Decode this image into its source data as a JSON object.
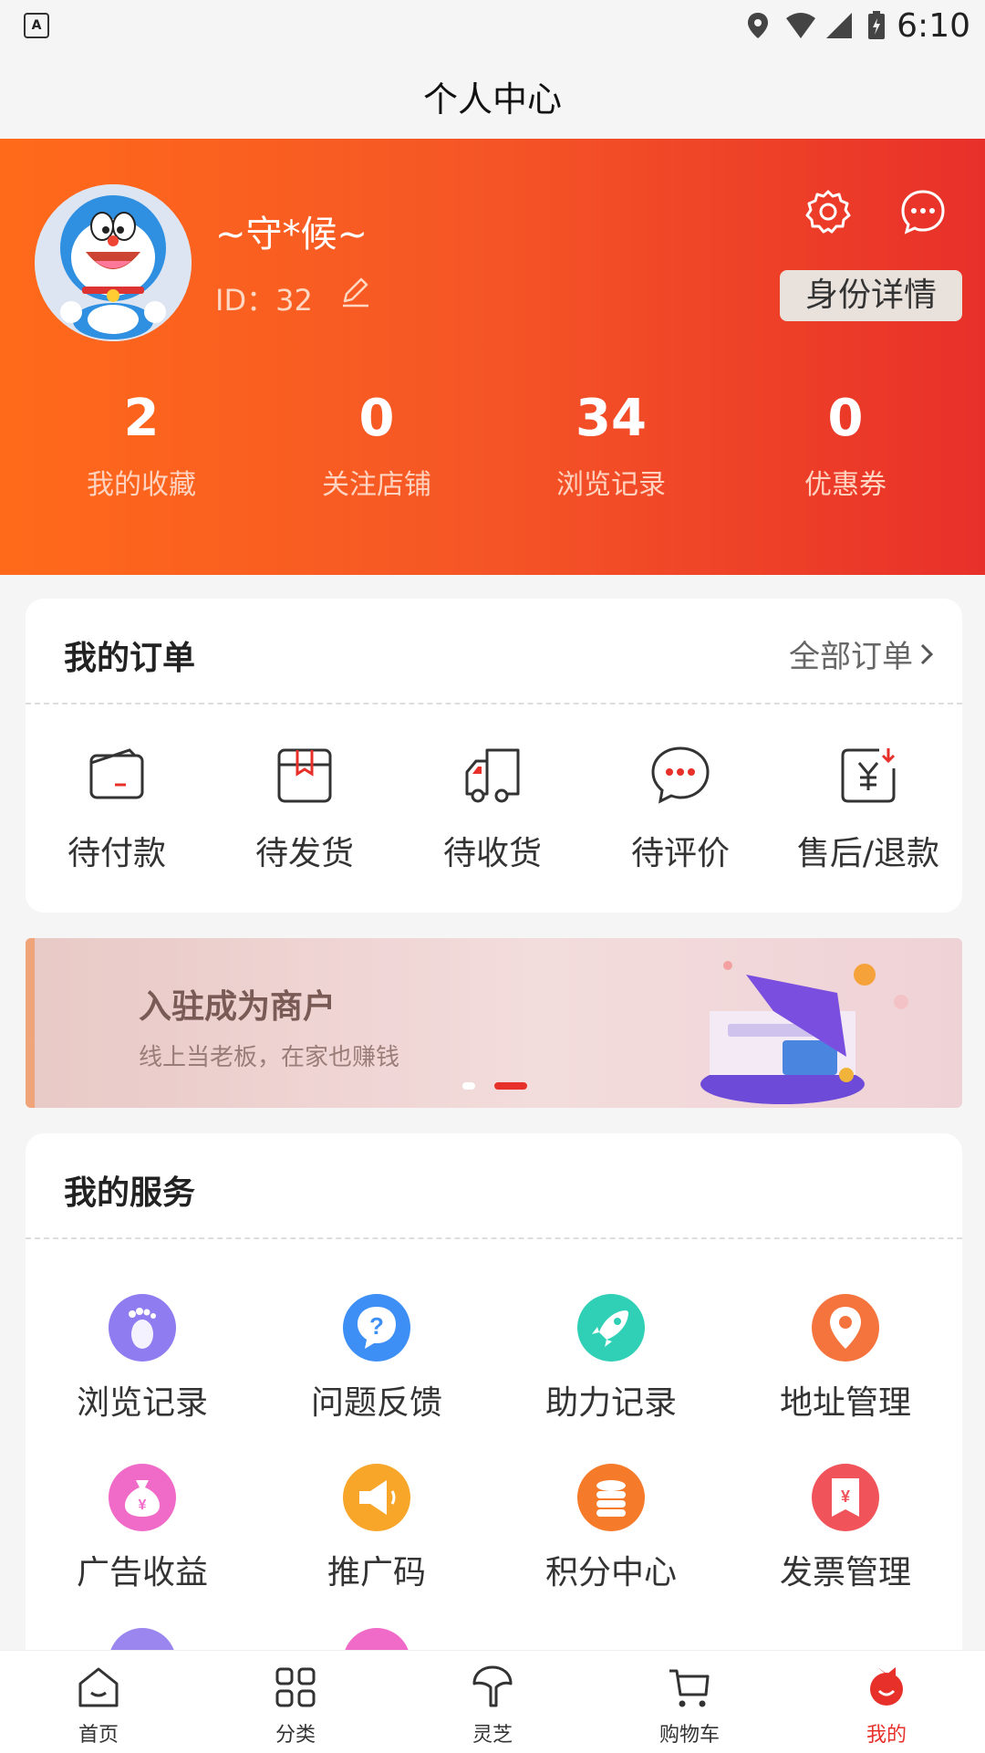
{
  "status_bar": {
    "time": "6:10"
  },
  "header": {
    "title": "个人中心"
  },
  "profile": {
    "username": "~守*候~",
    "id_text": "ID：32",
    "identity_button": "身份详情",
    "stats": [
      {
        "value": "2",
        "label": "我的收藏"
      },
      {
        "value": "0",
        "label": "关注店铺"
      },
      {
        "value": "34",
        "label": "浏览记录"
      },
      {
        "value": "0",
        "label": "优惠券"
      }
    ]
  },
  "orders": {
    "title": "我的订单",
    "all_link": "全部订单",
    "items": [
      {
        "label": "待付款",
        "icon": "wallet-icon"
      },
      {
        "label": "待发货",
        "icon": "box-icon"
      },
      {
        "label": "待收货",
        "icon": "truck-icon"
      },
      {
        "label": "待评价",
        "icon": "comment-icon"
      },
      {
        "label": "售后/退款",
        "icon": "refund-icon"
      }
    ]
  },
  "banner": {
    "title": "入驻成为商户",
    "subtitle": "线上当老板，在家也赚钱"
  },
  "services": {
    "title": "我的服务",
    "items": [
      {
        "label": "浏览记录",
        "icon": "footprint-icon",
        "color": "#8f7cf0"
      },
      {
        "label": "问题反馈",
        "icon": "question-icon",
        "color": "#3d8ff5"
      },
      {
        "label": "助力记录",
        "icon": "rocket-icon",
        "color": "#2fd0b5"
      },
      {
        "label": "地址管理",
        "icon": "location-icon",
        "color": "#f5743d"
      },
      {
        "label": "广告收益",
        "icon": "moneybag-icon",
        "color": "#f06bc8"
      },
      {
        "label": "推广码",
        "icon": "megaphone-icon",
        "color": "#f7a62a"
      },
      {
        "label": "积分中心",
        "icon": "coins-icon",
        "color": "#f57a2a"
      },
      {
        "label": "发票管理",
        "icon": "invoice-icon",
        "color": "#f0545a"
      }
    ]
  },
  "tabbar": {
    "tabs": [
      {
        "label": "首页",
        "icon": "home-icon"
      },
      {
        "label": "分类",
        "icon": "category-icon"
      },
      {
        "label": "灵芝",
        "icon": "mushroom-icon"
      },
      {
        "label": "购物车",
        "icon": "cart-icon"
      },
      {
        "label": "我的",
        "icon": "profile-icon",
        "active": true
      }
    ]
  }
}
